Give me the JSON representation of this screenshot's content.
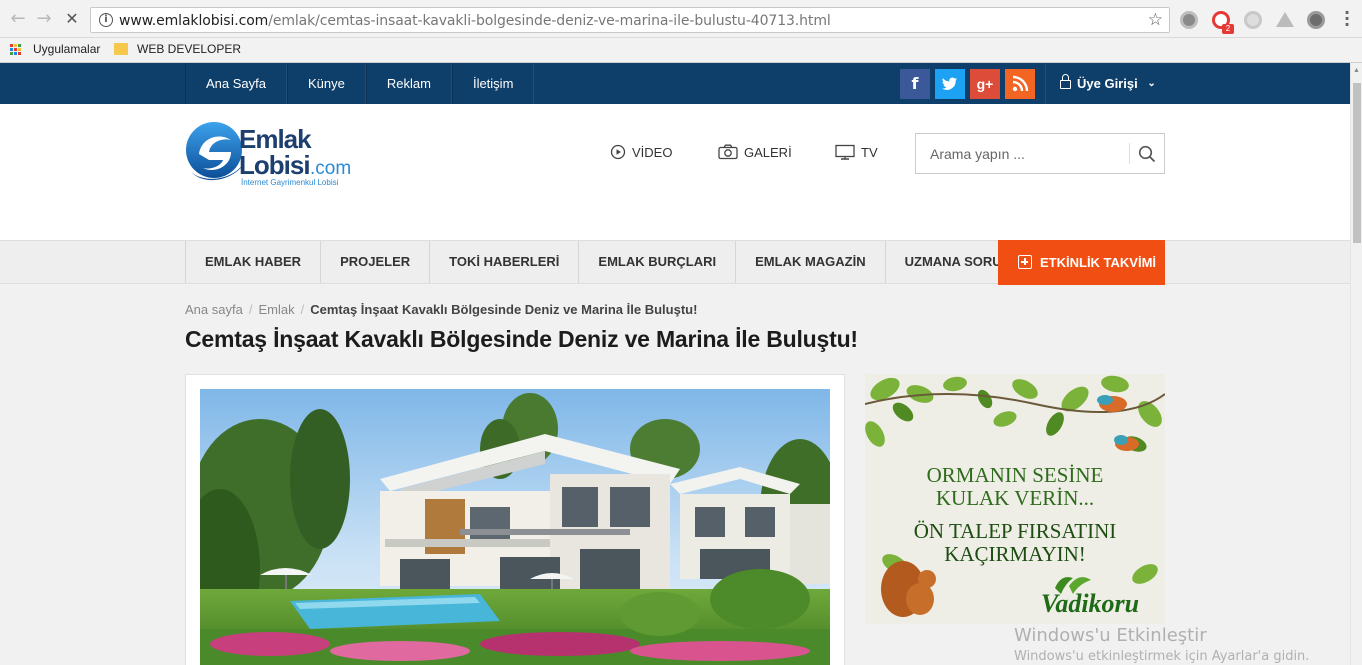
{
  "browser": {
    "back_icon": "←",
    "forward_icon": "→",
    "reload_icon": "✕",
    "info_icon": "i",
    "url_domain": "www.emlaklobisi.com",
    "url_path": "/emlak/cemtas-insaat-kavakli-bolgesinde-deniz-ve-marina-ile-bulustu-40713.html",
    "star_icon": "☆",
    "ext_badge": "2",
    "bookmarks": [
      {
        "label": "Uygulamalar",
        "icon": "apps-icon"
      },
      {
        "label": "WEB DEVELOPER",
        "icon": "folder-icon"
      }
    ]
  },
  "topbar": {
    "nav": [
      "Ana Sayfa",
      "Künye",
      "Reklam",
      "İletişim"
    ],
    "social": [
      {
        "name": "facebook-icon",
        "glyph": "f",
        "color": "#3b5998"
      },
      {
        "name": "twitter-icon",
        "glyph": "t",
        "color": "#1da1f2"
      },
      {
        "name": "google-plus-icon",
        "glyph": "g+",
        "color": "#dd4b39"
      },
      {
        "name": "rss-icon",
        "glyph": "",
        "color": "#f26522"
      }
    ],
    "login_label": "Üye Girişi",
    "login_caret": "⌄"
  },
  "header": {
    "logo": {
      "line1": "Emlak",
      "line2": "Lobisi",
      "tld": ".com",
      "tagline": "İnternet Gayrimenkul Lobisi"
    },
    "links": [
      {
        "label": "VİDEO",
        "icon": "play-icon"
      },
      {
        "label": "GALERİ",
        "icon": "camera-icon"
      },
      {
        "label": "TV",
        "icon": "monitor-icon"
      }
    ],
    "search_placeholder": "Arama yapın ..."
  },
  "categories": [
    "EMLAK HABER",
    "PROJELER",
    "TOKİ HABERLERİ",
    "EMLAK BURÇLARI",
    "EMLAK MAGAZİN",
    "UZMANA SORUN"
  ],
  "etkinlik_label": "ETKİNLİK TAKVİMİ",
  "breadcrumb": {
    "home": "Ana sayfa",
    "section": "Emlak",
    "current": "Cemtaş İnşaat Kavaklı Bölgesinde Deniz ve Marina İle Buluştu!"
  },
  "article": {
    "title": "Cemtaş İnşaat Kavaklı Bölgesinde Deniz ve Marina İle Buluştu!"
  },
  "ad": {
    "line1": "ORMANIN SESİNE",
    "line2": "KULAK VERİN...",
    "line3": "ÖN TALEP FIRSATINI",
    "line4": "KAÇIRMAYIN!",
    "brand": "Vadikoru"
  },
  "watermark": {
    "title": "Windows'u Etkinleştir",
    "subtitle": "Windows'u etkinleştirmek için Ayarlar'a gidin."
  },
  "colors": {
    "topbar": "#0e3e6a",
    "accent": "#f04e12",
    "logo_blue": "#1a73c8"
  }
}
